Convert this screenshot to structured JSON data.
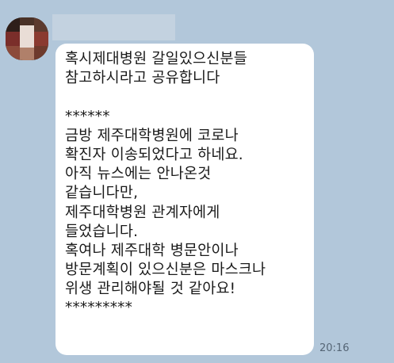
{
  "chat": {
    "background_color": "#b2c7da",
    "sender": {
      "name": "",
      "avatar_icon": "profile-avatar-pixelated"
    },
    "message": {
      "lines": [
        "혹시제대병원 갈일있으신분들",
        "참고하시라고 공유합니다",
        "",
        "******",
        "금방 제주대학병원에 코로나",
        "확진자 이송되었다고 하네요.",
        "아직 뉴스에는 안나온것",
        "같습니다만,",
        "제주대학병원 관계자에게",
        "들었습니다.",
        "혹여나 제주대학 병문안이나",
        "방문계획이 있으신분은 마스크나",
        "위생 관리해야될 것 같아요!",
        "*********"
      ],
      "time": "20:16"
    }
  }
}
